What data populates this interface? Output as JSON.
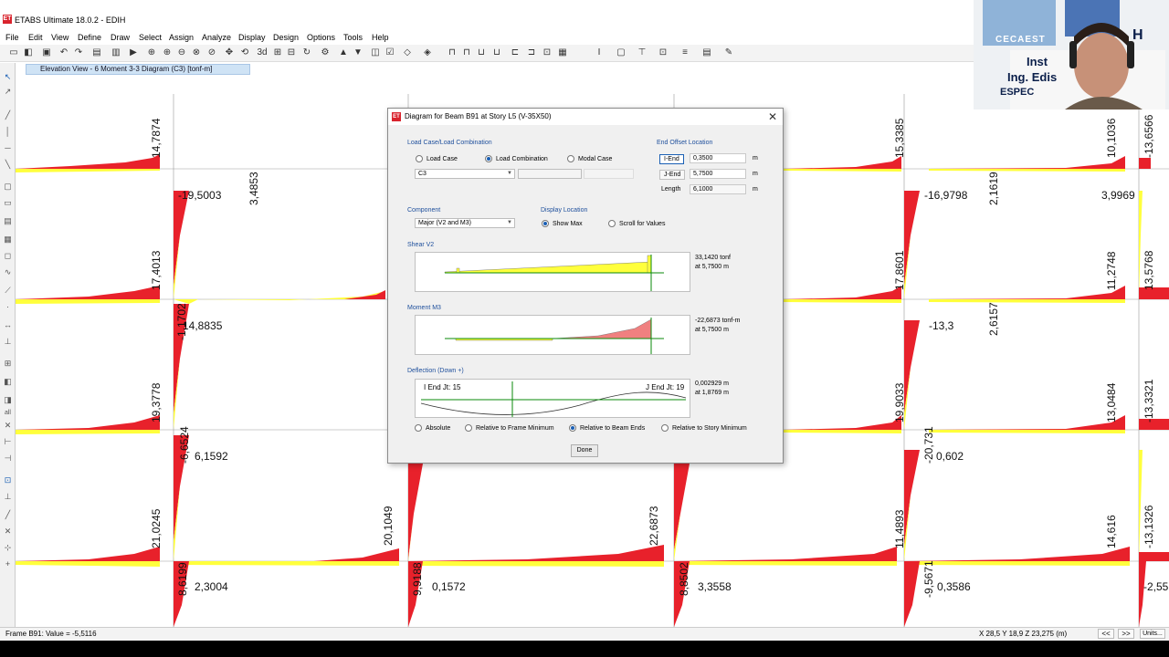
{
  "app": {
    "title": "ETABS Ultimate 18.0.2 - EDIH",
    "logo_text": "ET"
  },
  "menu": [
    "File",
    "Edit",
    "View",
    "Define",
    "Draw",
    "Select",
    "Assign",
    "Analyze",
    "Display",
    "Design",
    "Options",
    "Tools",
    "Help"
  ],
  "view_tab": "Elevation View - 6   Moment 3-3 Diagram   (C3)  [tonf-m]",
  "diagram_labels": [
    "14,7874",
    "3,4853",
    "-19,5003",
    "17,4013",
    "14,8835",
    "-1,1702",
    "19,3778",
    "-6,6524",
    "6,1592",
    "21,0245",
    "20,1049",
    "22,6873",
    "9,9188",
    "0,1572",
    "8,6199",
    "2,3004",
    "8,8502",
    "3,3558",
    "15,3385",
    "10,1036",
    "-13,6566",
    "-16,9798",
    "2,1619",
    "3,9969",
    "17,8601",
    "11,2748",
    "13,5768",
    "-13,3",
    "2,6157",
    "19,9033",
    "13,0484",
    "-13,3321",
    "-20,731",
    "0,602",
    "11,4893",
    "14,616",
    "-13,1326",
    "-9,5671",
    "0,3586",
    "-2,55"
  ],
  "dialog": {
    "title": "Diagram for Beam B91 at Story L5 (V-35X50)",
    "load_case_group": "Load Case/Load Combination",
    "radio_load_case": "Load Case",
    "radio_load_combination": "Load Combination",
    "radio_modal_case": "Modal Case",
    "combo_value": "C3",
    "end_offset_group": "End Offset Location",
    "i_end_label": "I-End",
    "i_end_value": "0,3500",
    "j_end_label": "J-End",
    "j_end_value": "5,7500",
    "length_label": "Length",
    "length_value": "6,1000",
    "unit_m": "m",
    "component_group": "Component",
    "component_value": "Major (V2 and M3)",
    "display_location_group": "Display Location",
    "radio_show_max": "Show Max",
    "radio_scroll": "Scroll for Values",
    "shear_group": "Shear V2",
    "shear_value": "33,1420 tonf",
    "shear_at": "at 5,7500 m",
    "moment_group": "Moment M3",
    "moment_value": "-22,6873 tonf-m",
    "moment_at": "at 5,7500 m",
    "deflection_group": "Deflection (Down +)",
    "i_end_joint": "I End Jt: 15",
    "j_end_joint": "J End Jt: 19",
    "deflection_value": "0,002929 m",
    "deflection_at": "at 1,8769 m",
    "radio_absolute": "Absolute",
    "radio_rel_frame": "Relative to Frame Minimum",
    "radio_rel_beam": "Relative to Beam Ends",
    "radio_rel_story": "Relative to Story Minimum",
    "done": "Done"
  },
  "status": {
    "left": "Frame B91:  Value = -5,5116",
    "coords": "X 28,5  Y 18,9  Z 23,275 (m)",
    "nav_prev": "<<",
    "nav_next": ">>",
    "units": "Units..."
  },
  "webcam": {
    "logo": "CECAEST",
    "line1": "Inst",
    "line2": "Ing. Edis",
    "line3": "ESPEC",
    "line_right": "H"
  },
  "colors": {
    "moment_negative": "#e8212b",
    "moment_positive": "#ffff3c",
    "window_bg": "#f0f0f0",
    "accent_blue": "#1e4f9c"
  }
}
